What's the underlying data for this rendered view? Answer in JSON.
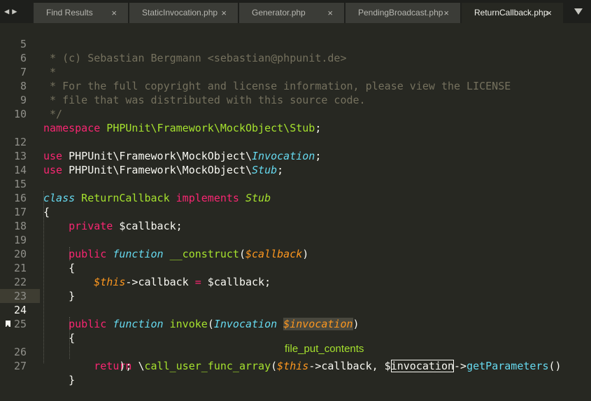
{
  "tabs": [
    {
      "label": "Find Results",
      "active": false
    },
    {
      "label": "StaticInvocation.php",
      "active": false
    },
    {
      "label": "Generator.php",
      "active": false
    },
    {
      "label": "PendingBroadcast.php",
      "active": false
    },
    {
      "label": "ReturnCallback.php",
      "active": true
    }
  ],
  "tab_close_glyph": "×",
  "nav_glyphs": "◀▶",
  "line_numbers": [
    "5",
    "6",
    "7",
    "8",
    "9",
    "10",
    "",
    "12",
    "13",
    "14",
    "15",
    "16",
    "17",
    "18",
    "19",
    "20",
    "21",
    "22",
    "23",
    "24",
    "25",
    "26",
    "",
    "27"
  ],
  "current_line": "24",
  "bookmark_line": "26",
  "code": {
    "l5": " * (c) Sebastian Bergmann <sebastian@phpunit.de>",
    "l6": " *",
    "l7": " * For the full copyright and license information, please view the LICENSE",
    "l8": " * file that was distributed with this source code.",
    "l9": " */",
    "l10_kw": "namespace",
    "l10_ns": " PHPUnit\\Framework\\MockObject\\Stub",
    "l10_end": ";",
    "l12_kw": "use",
    "l12_ns": " PHPUnit\\Framework\\MockObject\\",
    "l12_type": "Invocation",
    "l12_end": ";",
    "l13_kw": "use",
    "l13_ns": " PHPUnit\\Framework\\MockObject\\",
    "l13_type": "Stub",
    "l13_end": ";",
    "l15_kw": "class",
    "l15_cls": " ReturnCallback ",
    "l15_impl": "implements",
    "l15_inh": " Stub",
    "l16": "{",
    "l17_kw": "    private",
    "l17_var": " $callback;",
    "l19_kw": "    public",
    "l19_fnkw": " function",
    "l19_name": " __construct",
    "l19_open": "(",
    "l19_par": "$callback",
    "l19_close": ")",
    "l20": "    {",
    "l21_this": "        $this",
    "l21_rest": "->callback ",
    "l21_eq": "=",
    "l21_val": " $callback;",
    "l22": "    }",
    "l24_kw": "    public",
    "l24_fnkw": " function",
    "l24_name": " invoke",
    "l24_open": "(",
    "l24_type": "Invocation",
    "l24_sp": " ",
    "l24_par": "$invocation",
    "l24_close": ")",
    "l25": "    {",
    "l26_kw": "        return",
    "l26_sp": " \\",
    "l26_fn": "call_user_func_array",
    "l26_open": "(",
    "l26_this": "$this",
    "l26_mid": "->callback, $",
    "l26_box": "invocation",
    "l26_arrow": "->",
    "l26_method": "getParameters",
    "l26_end": "()",
    "l26b": "            );",
    "l27": "    }"
  },
  "autocomplete_hint": "file_put_contents"
}
